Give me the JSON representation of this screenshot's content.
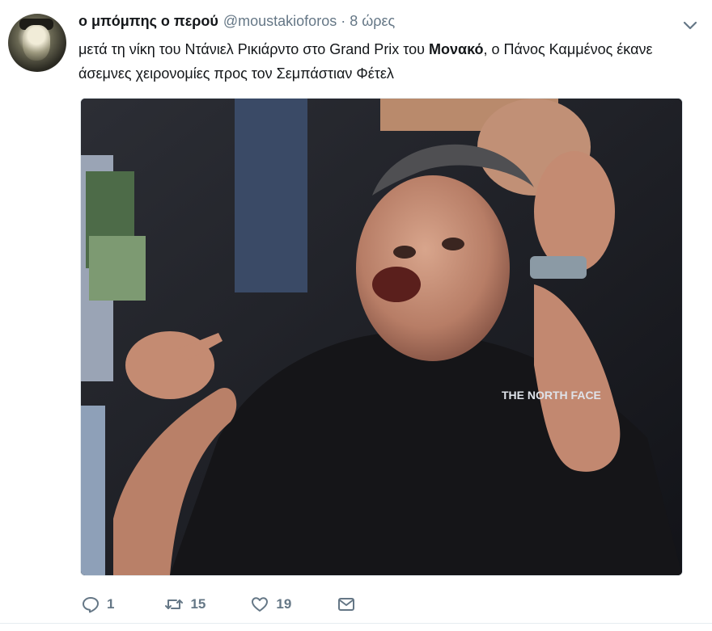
{
  "tweet": {
    "display_name": "ο μπόμπης ο περού",
    "handle": "@moustakioforos",
    "separator": "·",
    "time": "8 ώρες",
    "text_part1": "μετά τη νίκη του Ντάνιελ Ρικιάρντο στο Grand Prix του ",
    "text_bold": "Μονακό",
    "text_part2": ", ο Πάνος Καμμένος έκανε άσεμνες χειρονομίες προς τον Σεμπάστιαν Φέτελ",
    "photo_logo": "THE NORTH FACE"
  },
  "actions": {
    "reply_count": "1",
    "retweet_count": "15",
    "like_count": "19"
  },
  "icons": {
    "menu": "chevron-down-icon",
    "reply": "reply-icon",
    "retweet": "retweet-icon",
    "like": "heart-icon",
    "message": "envelope-icon"
  },
  "colors": {
    "text": "#14171a",
    "muted": "#657786"
  }
}
